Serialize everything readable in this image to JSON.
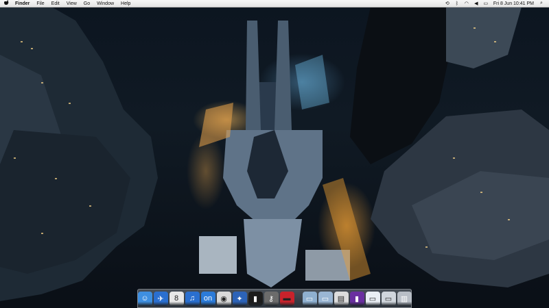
{
  "menubar": {
    "apple_icon": "apple-logo",
    "items": [
      "Finder",
      "File",
      "Edit",
      "View",
      "Go",
      "Window",
      "Help"
    ],
    "status": {
      "clock": "Fri 8 Jun 10:41 PM",
      "icons": [
        "time-machine-icon",
        "bluetooth-icon",
        "wifi-icon",
        "volume-icon",
        "battery-icon",
        "spotlight-icon"
      ]
    }
  },
  "dock": {
    "apps": [
      {
        "name": "finder-icon",
        "glyph": "☺",
        "color": "#3e8fe0"
      },
      {
        "name": "mail-icon",
        "glyph": "✈",
        "color": "#2a6fd0"
      },
      {
        "name": "calendar-icon",
        "glyph": "8",
        "color": "#e7e7e7"
      },
      {
        "name": "itunes-icon",
        "glyph": "♫",
        "color": "#2a6fcf"
      },
      {
        "name": "app-store-icon",
        "glyph": "on",
        "color": "#2b7bd8"
      },
      {
        "name": "chrome-icon",
        "glyph": "◉",
        "color": "#d9d9d9"
      },
      {
        "name": "bird-app-icon",
        "glyph": "✦",
        "color": "#2c63b8"
      },
      {
        "name": "terminal-icon",
        "glyph": "▮",
        "color": "#1c1c1c"
      },
      {
        "name": "key-utility-icon",
        "glyph": "⚷",
        "color": "#6b6b6b"
      },
      {
        "name": "flashcard-app-icon",
        "glyph": "▬",
        "color": "#c8222b"
      }
    ],
    "folders": [
      {
        "name": "applications-folder-icon",
        "glyph": "▭",
        "color": "#8fb0d0"
      },
      {
        "name": "documents-folder-icon",
        "glyph": "▭",
        "color": "#9ab6d4"
      },
      {
        "name": "screenshot-stack-icon",
        "glyph": "▤",
        "color": "#dcdcdc"
      },
      {
        "name": "purple-stack-icon",
        "glyph": "▮",
        "color": "#6a2fa0"
      },
      {
        "name": "downloads-stack-icon",
        "glyph": "▭",
        "color": "#e9eef4"
      },
      {
        "name": "network-stack-icon",
        "glyph": "▭",
        "color": "#d0d6dd"
      },
      {
        "name": "trash-icon",
        "glyph": "▥",
        "color": "#b8bec6"
      }
    ]
  }
}
